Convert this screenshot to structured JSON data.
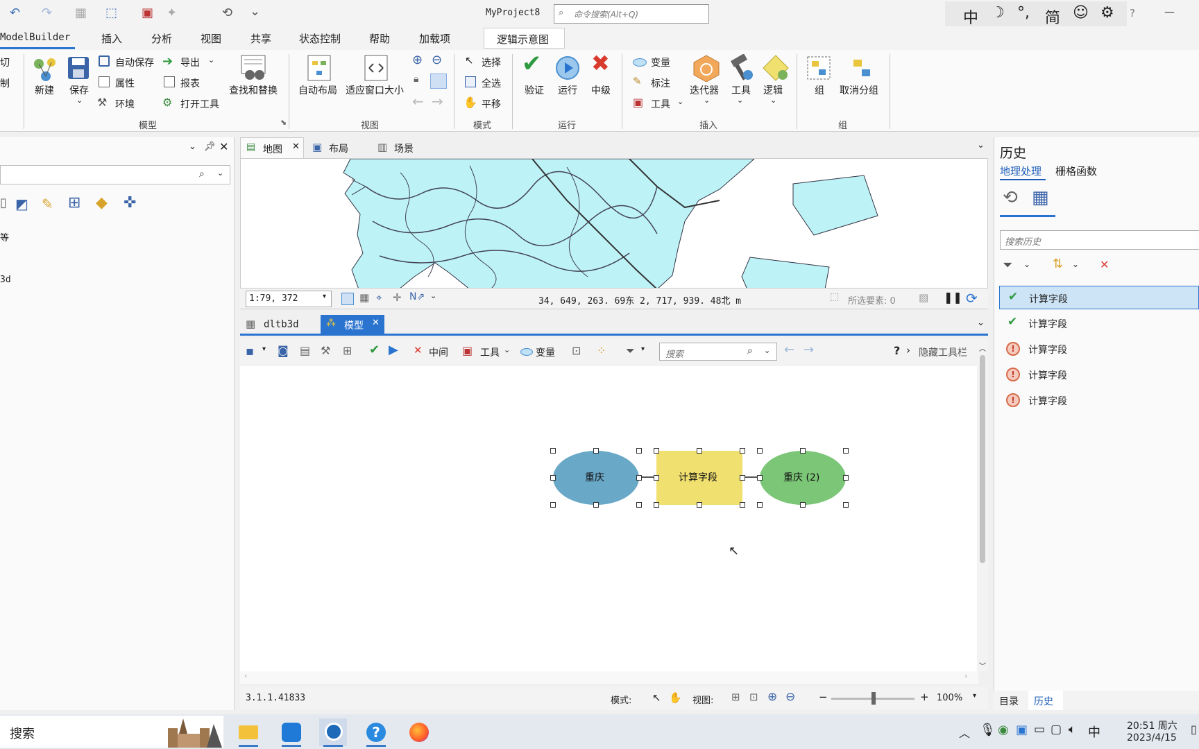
{
  "titlebar": {
    "project": "MyProject8",
    "search_placeholder": "命令搜索(Alt+Q)",
    "ime": [
      "中",
      "☽",
      "°,",
      "简",
      "☺",
      "⚙"
    ],
    "help": "?",
    "minimize": "—"
  },
  "ribbon": {
    "tabs": [
      "ModelBuilder",
      "插入",
      "分析",
      "视图",
      "共享",
      "状态控制",
      "帮助",
      "加载项"
    ],
    "context_tab": "逻辑示意图",
    "left_cut": [
      "切",
      "制"
    ],
    "model_group": {
      "label": "模型",
      "new": "新建",
      "save": "保存",
      "autosave": "自动保存",
      "properties": "属性",
      "environment": "环境",
      "export": "导出",
      "report": "报表",
      "open_tool": "打开工具",
      "find_replace": "查找和替换"
    },
    "view_group": {
      "label": "视图",
      "auto_layout": "自动布局",
      "fit_window": "适应窗口大小"
    },
    "mode_group": {
      "label": "模式",
      "select": "选择",
      "select_all": "全选",
      "pan": "平移"
    },
    "run_group": {
      "label": "运行",
      "validate": "验证",
      "run": "运行",
      "intermediate": "中级"
    },
    "insert_group": {
      "label": "插入",
      "variable": "变量",
      "label_item": "标注",
      "tools": "工具",
      "iterator": "迭代器",
      "tool": "工具",
      "logic": "逻辑"
    },
    "group_group": {
      "label": "组",
      "group": "组",
      "ungroup": "取消分组"
    }
  },
  "left_panel": {
    "truncated_items": [
      "等",
      "3d"
    ]
  },
  "map": {
    "tabs": [
      "地图",
      "布局",
      "场景"
    ],
    "scale": "1:79, 372",
    "coords": "34, 649, 263. 69东  2, 717, 939. 48北 m",
    "selected": "所选要素: 0"
  },
  "model": {
    "tabs": [
      "dltb3d",
      "模型"
    ],
    "toolbar": {
      "intermediate": "中间",
      "tools": "工具",
      "variable": "变量",
      "search_placeholder": "搜索",
      "hide_toolbar": "隐藏工具栏"
    },
    "nodes": {
      "input": "重庆",
      "process": "计算字段",
      "output": "重庆 (2)"
    },
    "version": "3.1.1.41833",
    "status": {
      "mode_label": "模式:",
      "view_label": "视图:",
      "zoom": "100%"
    },
    "colors": {
      "input": "#6aa8c8",
      "process": "#f0e070",
      "output": "#7cc678"
    }
  },
  "history": {
    "title": "历史",
    "tabs": [
      "地理处理",
      "栅格函数"
    ],
    "search_placeholder": "搜索历史",
    "items": [
      {
        "label": "计算字段",
        "status": "success"
      },
      {
        "label": "计算字段",
        "status": "success"
      },
      {
        "label": "计算字段",
        "status": "error"
      },
      {
        "label": "计算字段",
        "status": "error"
      },
      {
        "label": "计算字段",
        "status": "error"
      }
    ],
    "bottom_tabs": [
      "目录",
      "历史"
    ]
  },
  "taskbar": {
    "search": "搜索",
    "time": "20:51 周六",
    "date": "2023/4/15",
    "ime": "中"
  }
}
